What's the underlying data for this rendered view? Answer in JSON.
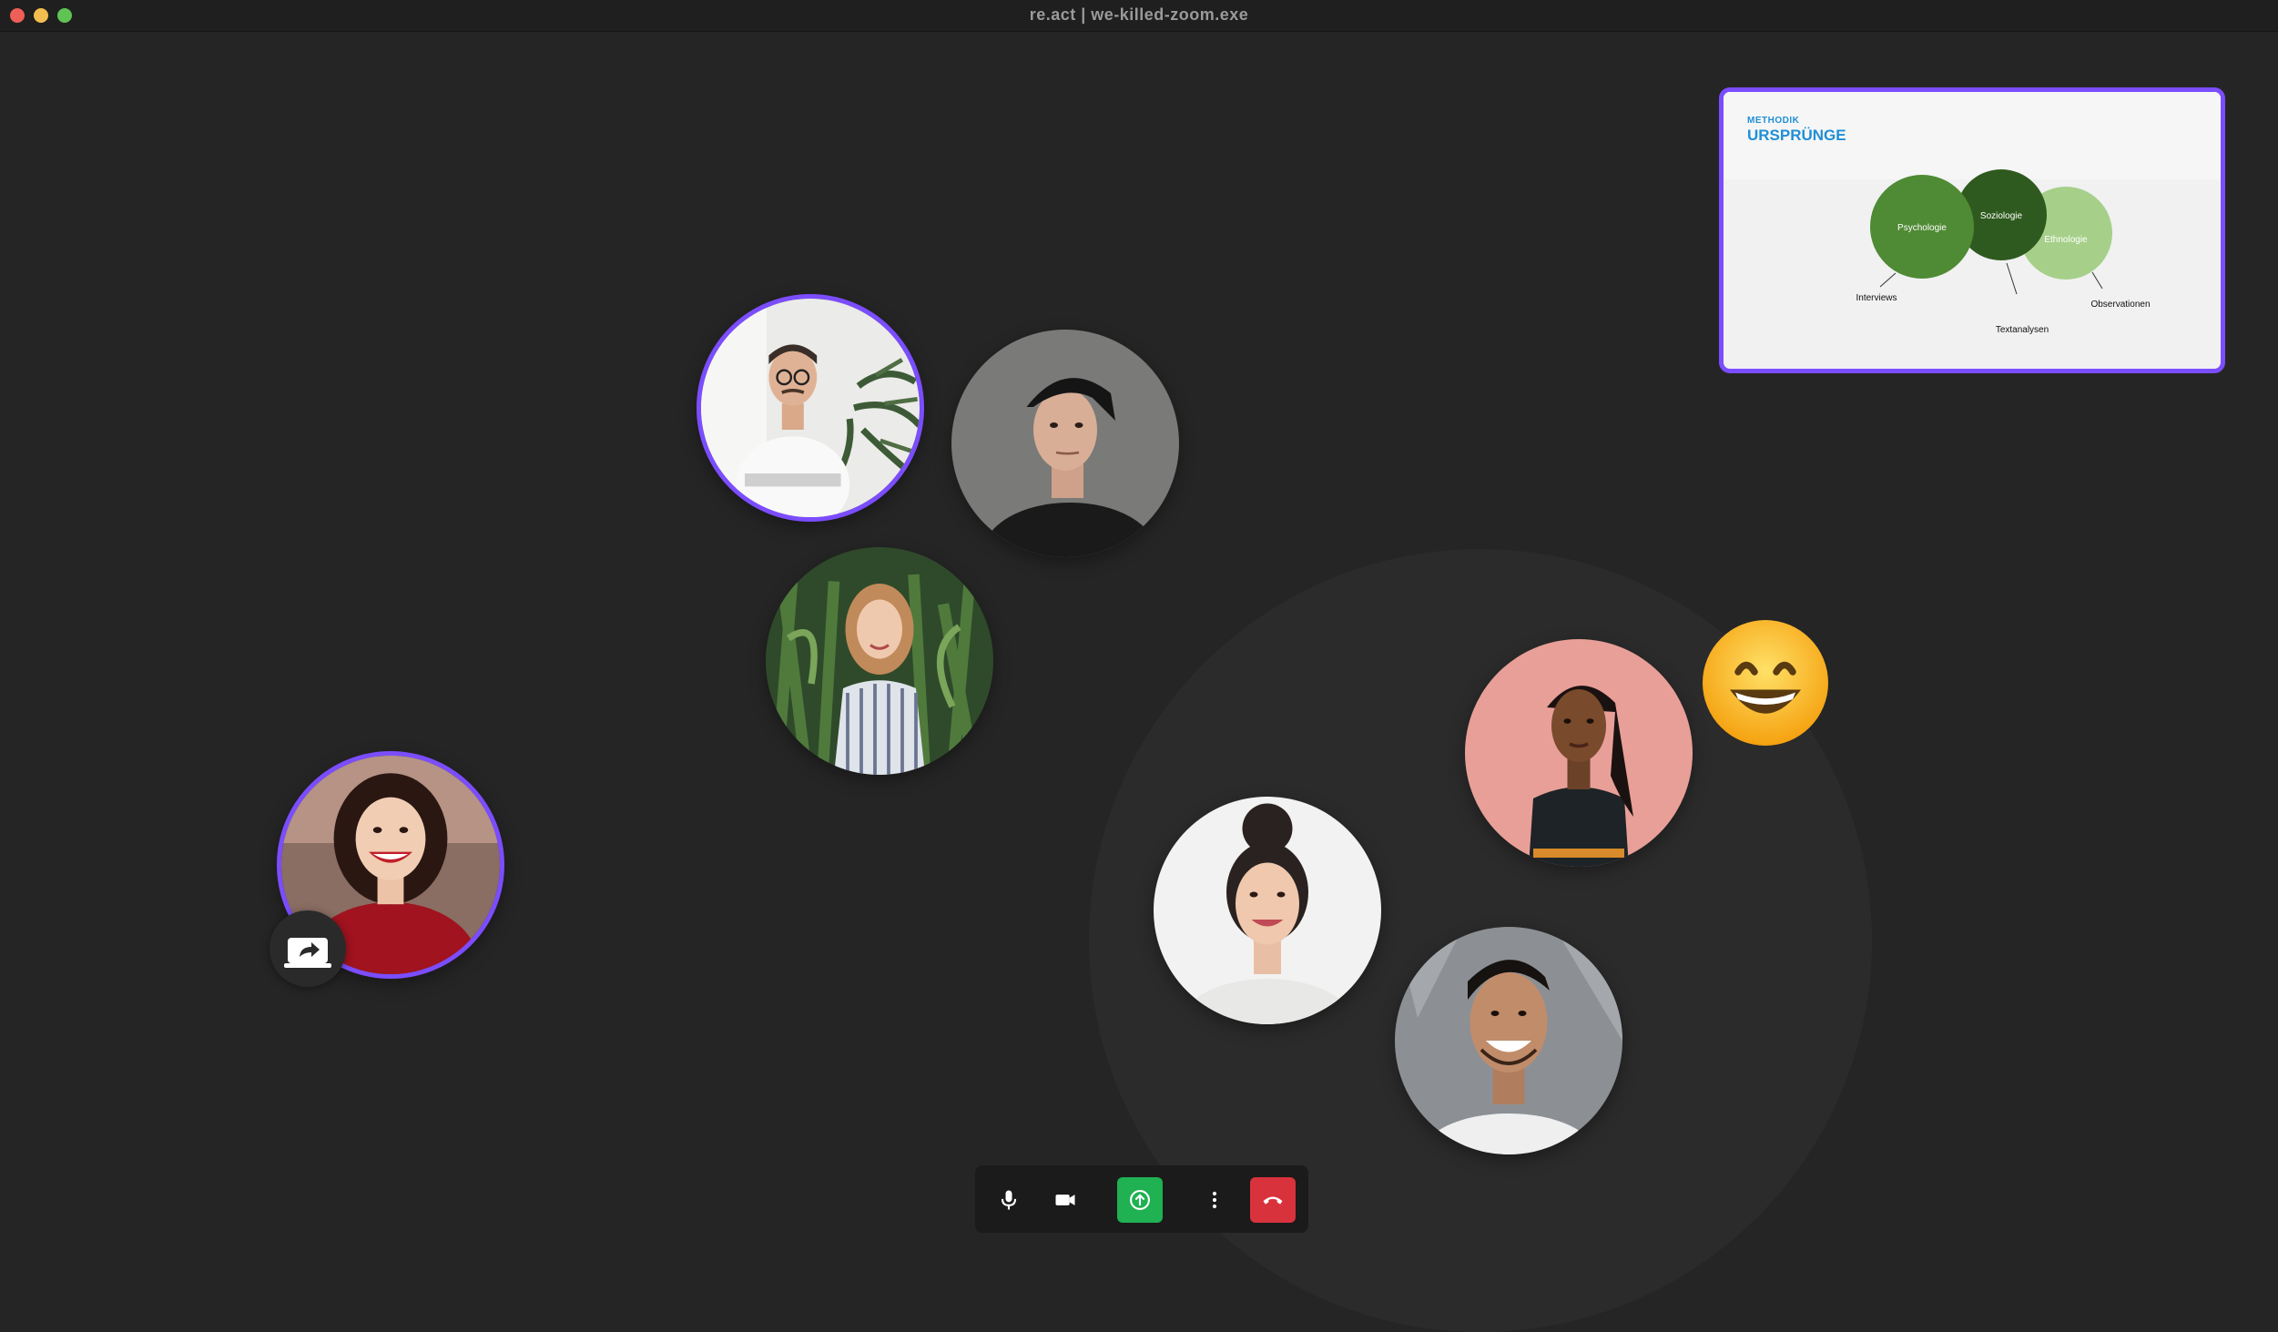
{
  "window": {
    "title": "re.act  |  we-killed-zoom.exe"
  },
  "slide": {
    "kicker": "METHODIK",
    "title": "URSPRÜNGE",
    "circles": [
      "Psychologie",
      "Soziologie",
      "Ethnologie"
    ],
    "labels": [
      "Interviews",
      "Textanalysen",
      "Observationen"
    ],
    "colors": {
      "psychologie": "#4f8a34",
      "soziologie": "#2f5a1f",
      "ethnologie": "#a6d08a"
    }
  },
  "participants": [
    {
      "name": "participant-man-glasses",
      "speaking": true
    },
    {
      "name": "participant-man-cap",
      "speaking": false
    },
    {
      "name": "participant-woman-striped-dress",
      "speaking": false
    },
    {
      "name": "participant-woman-red-top",
      "speaking": true,
      "sharing": true
    },
    {
      "name": "participant-woman-pink-bg",
      "speaking": false,
      "reaction": "grinning-face"
    },
    {
      "name": "participant-woman-bun",
      "speaking": false
    },
    {
      "name": "participant-man-smiling",
      "speaking": false
    }
  ],
  "controls": {
    "mic": "microphone-icon",
    "camera": "camera-icon",
    "share": "share-screen-icon",
    "more": "more-vertical-icon",
    "end": "end-call-icon"
  },
  "colors": {
    "accent": "#7b4dff",
    "share_green": "#1fb152",
    "end_red": "#d8323c"
  }
}
